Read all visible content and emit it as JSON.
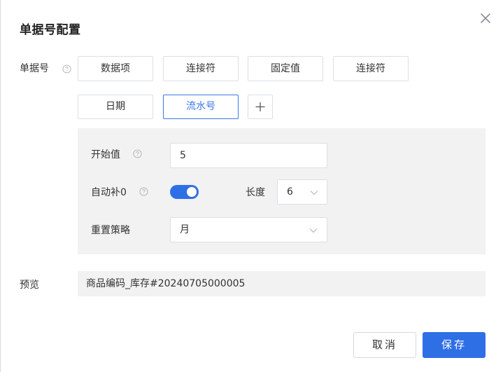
{
  "dialog": {
    "title": "单据号配置",
    "close_icon": "close-icon"
  },
  "doc_no": {
    "label": "单据号",
    "help_icon": "question-circle-icon",
    "segments": [
      {
        "label": "数据项",
        "active": false
      },
      {
        "label": "连接符",
        "active": false
      },
      {
        "label": "固定值",
        "active": false
      },
      {
        "label": "连接符",
        "active": false
      },
      {
        "label": "日期",
        "active": false
      },
      {
        "label": "流水号",
        "active": true
      }
    ],
    "add_icon": "plus-icon"
  },
  "serial_config": {
    "start_value": {
      "label": "开始值",
      "value": "5"
    },
    "auto_pad": {
      "label": "自动补0",
      "enabled": true
    },
    "length": {
      "label": "长度",
      "value": "6"
    },
    "reset_policy": {
      "label": "重置策略",
      "value": "月"
    }
  },
  "preview": {
    "label": "预览",
    "value": "商品编码_库存#20240705000005"
  },
  "footer": {
    "cancel_label": "取消",
    "save_label": "保存"
  },
  "colors": {
    "accent": "#2f6fe6",
    "active_border": "#3c78e8",
    "panel_bg": "#f2f2f2"
  }
}
